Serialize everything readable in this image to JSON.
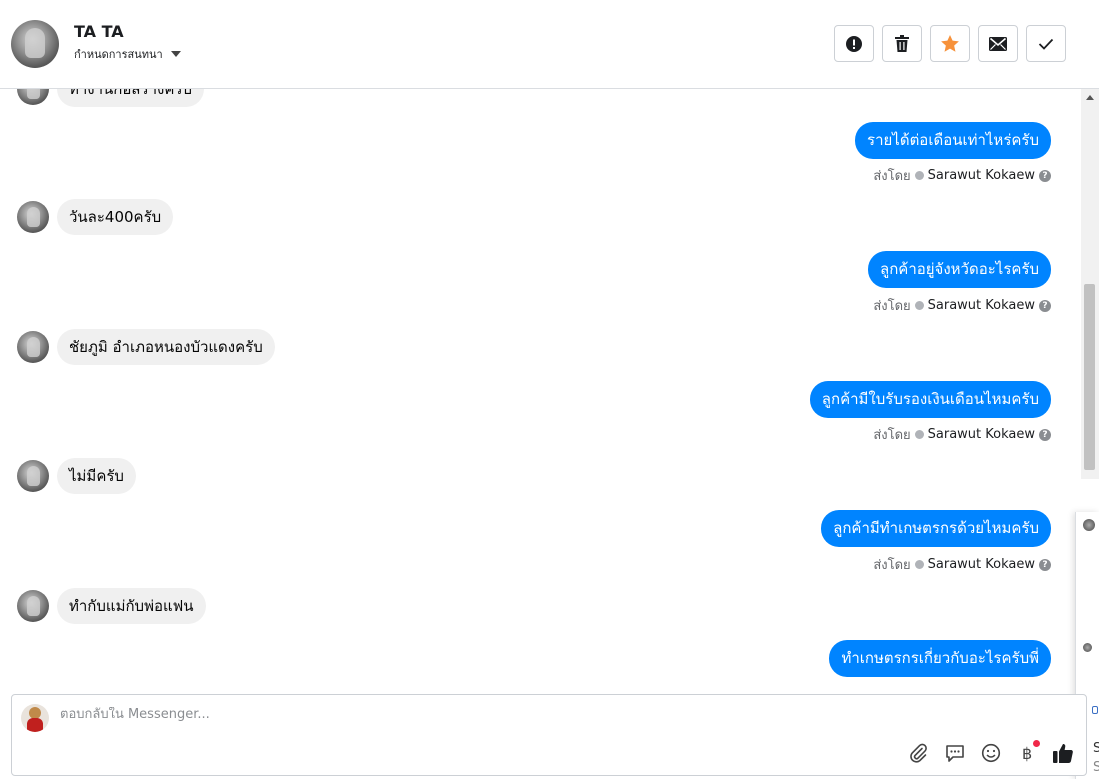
{
  "header": {
    "contact_name": "TA TA",
    "assign_label": "กำหนดการสนทนา",
    "actions": [
      {
        "icon": "alert-icon",
        "label": "Mark as spam"
      },
      {
        "icon": "trash-icon",
        "label": "Delete"
      },
      {
        "icon": "star-icon",
        "label": "Follow up"
      },
      {
        "icon": "envelope-icon",
        "label": "Mark as unread"
      },
      {
        "icon": "check-icon",
        "label": "Mark as done"
      }
    ]
  },
  "messages": [
    {
      "dir": "in",
      "text": "ทำงานก่อสร้างครับ",
      "partial": true
    },
    {
      "dir": "out",
      "text": "รายได้ต่อเดือนเท่าไหร่ครับ",
      "sent_by_label": "ส่งโดย",
      "sender": "Sarawut Kokaew"
    },
    {
      "dir": "in",
      "text": "วันละ400ครับ"
    },
    {
      "dir": "out",
      "text": "ลูกค้าอยู่จังหวัดอะไรครับ",
      "sent_by_label": "ส่งโดย",
      "sender": "Sarawut Kokaew"
    },
    {
      "dir": "in",
      "text": "ชัยภูมิ อำเภอหนองบัวแดงครับ"
    },
    {
      "dir": "out",
      "text": "ลูกค้ามีใบรับรองเงินเดือนไหมครับ",
      "sent_by_label": "ส่งโดย",
      "sender": "Sarawut Kokaew"
    },
    {
      "dir": "in",
      "text": "ไม่มีครับ"
    },
    {
      "dir": "out",
      "text": "ลูกค้ามีทำเกษตรกรด้วยไหมครับ",
      "sent_by_label": "ส่งโดย",
      "sender": "Sarawut Kokaew"
    },
    {
      "dir": "in",
      "text": "ทำกับแม่กับพ่อแฟน"
    },
    {
      "dir": "out",
      "text": "ทำเกษตรกรเกี่ยวกับอะไรครับพี่"
    }
  ],
  "composer": {
    "placeholder": "ตอบกลับใน Messenger...",
    "value": "",
    "tools": [
      "paperclip-icon",
      "saved-reply-icon",
      "emoji-icon",
      "baht-icon",
      "thumbs-up-icon"
    ]
  },
  "side_panel": {
    "text_line_1": "S",
    "text_line_2": "S"
  },
  "colors": {
    "outgoing_bubble": "#0084ff",
    "incoming_bubble": "#f0f0f0",
    "star": "#f7923b",
    "notification_dot": "#f02849"
  }
}
